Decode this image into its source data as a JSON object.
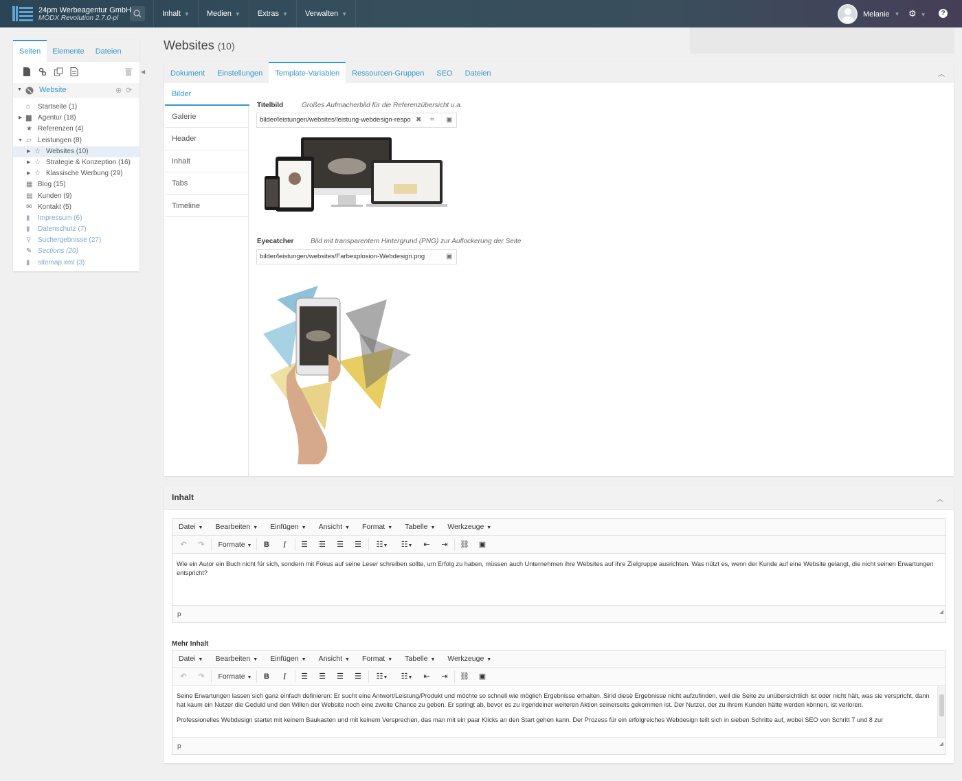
{
  "topbar": {
    "brand_name": "24pm Werbeagentur GmbH",
    "brand_version": "MODX Revolution 2.7.0-pl",
    "search_icon": "search-icon",
    "nav": [
      {
        "label": "Inhalt"
      },
      {
        "label": "Medien"
      },
      {
        "label": "Extras"
      },
      {
        "label": "Verwalten"
      }
    ],
    "user_name": "Melanie",
    "gear_icon": "gear-icon",
    "help_icon": "?"
  },
  "sidebar": {
    "tabs": [
      {
        "label": "Seiten"
      },
      {
        "label": "Elemente"
      },
      {
        "label": "Dateien"
      }
    ],
    "root_label": "Website",
    "tree": [
      {
        "label": "Startseite (1)",
        "icon": "home-icon"
      },
      {
        "label": "Agentur (18)",
        "icon": "folder-icon"
      },
      {
        "label": "Referenzen (4)",
        "icon": "star-icon"
      },
      {
        "label": "Leistungen (8)",
        "icon": "folder-open-icon"
      },
      {
        "label": "Websites (10)",
        "icon": "star-outline-icon"
      },
      {
        "label": "Strategie & Konzeption (16)",
        "icon": "star-outline-icon"
      },
      {
        "label": "Klassische Werbung (29)",
        "icon": "star-outline-icon"
      },
      {
        "label": "Blog (15)",
        "icon": "grid-icon"
      },
      {
        "label": "Kunden (9)",
        "icon": "id-card-icon"
      },
      {
        "label": "Kontakt (5)",
        "icon": "envelope-icon"
      },
      {
        "label": "Impressum (6)",
        "icon": "file-icon"
      },
      {
        "label": "Datenschutz (7)",
        "icon": "file-icon"
      },
      {
        "label": "Suchergebnisse (27)",
        "icon": "search-icon"
      },
      {
        "label": "Sections (20)",
        "icon": "wrench-icon"
      },
      {
        "label": "sitemap.xml (3)",
        "icon": "file-icon"
      }
    ]
  },
  "page": {
    "title": "Websites",
    "count": "(10)",
    "tabs": [
      {
        "label": "Dokument"
      },
      {
        "label": "Einstellungen"
      },
      {
        "label": "Template-Variablen"
      },
      {
        "label": "Ressourcen-Gruppen"
      },
      {
        "label": "SEO"
      },
      {
        "label": "Dateien"
      }
    ],
    "tv_categories": [
      {
        "label": "Bilder"
      },
      {
        "label": "Galerie"
      },
      {
        "label": "Header"
      },
      {
        "label": "Inhalt"
      },
      {
        "label": "Tabs"
      },
      {
        "label": "Timeline"
      }
    ],
    "tv1": {
      "label": "Titelbild",
      "description": "Großes Aufmacherbild für die Referenzübersicht u.a.",
      "value": "bilder/leistungen/websites/leistung-webdesign-respo"
    },
    "tv2": {
      "label": "Eyecatcher",
      "description": "Bild mit transparentem Hintergrund (PNG) zur Auflockerung der Seite",
      "value": "bilder/leistungen/websites/Farbexplosion-Webdesign.png"
    }
  },
  "content_panel": {
    "title": "Inhalt",
    "menu": [
      {
        "label": "Datei"
      },
      {
        "label": "Bearbeiten"
      },
      {
        "label": "Einfügen"
      },
      {
        "label": "Ansicht"
      },
      {
        "label": "Format"
      },
      {
        "label": "Tabelle"
      },
      {
        "label": "Werkzeuge"
      }
    ],
    "formats_label": "Formate",
    "editor1": {
      "text": "Wie ein Autor ein Buch nicht für sich, sondern mit Fokus auf seine Leser schreiben sollte, um Erfolg zu haben, müssen auch Unternehmen ihre Websites auf ihre Zielgruppe ausrichten. Was nützt es, wenn der Kunde auf eine Website gelangt, die nicht seinen Erwartungen entspricht?",
      "status": "p"
    },
    "mehr_label": "Mehr Inhalt",
    "editor2": {
      "paragraph1": "Seine Erwartungen lassen sich ganz einfach definieren: Er sucht eine Antwort/Leistung/Produkt und möchte so schnell wie möglich Ergebnisse erhalten. Sind diese Ergebnisse nicht aufzufinden, weil die Seite zu unübersichtlich ist oder nicht hält, was sie verspricht, dann hat kaum ein Nutzer die Geduld und den Willen der Website noch eine zweite Chance zu geben. Er springt ab, bevor es zu irgendeiner weiteren Aktion seinerseits gekommen ist. Der Nutzer, der zu ihrem Kunden hätte werden können, ist verloren.",
      "paragraph2": "Professionelles Webdesign startet mit keinem Baukasten und mit keinem Versprechen, das man mit ein paar Klicks an den Start gehen kann. Der Prozess für ein erfolgreiches Webdesign teilt sich in sieben Schritte auf, wobei SEO von Schritt 7 und 8 zur",
      "status": "p"
    }
  },
  "colors": {
    "accent": "#3697cd",
    "topbar": "#354f5d"
  }
}
